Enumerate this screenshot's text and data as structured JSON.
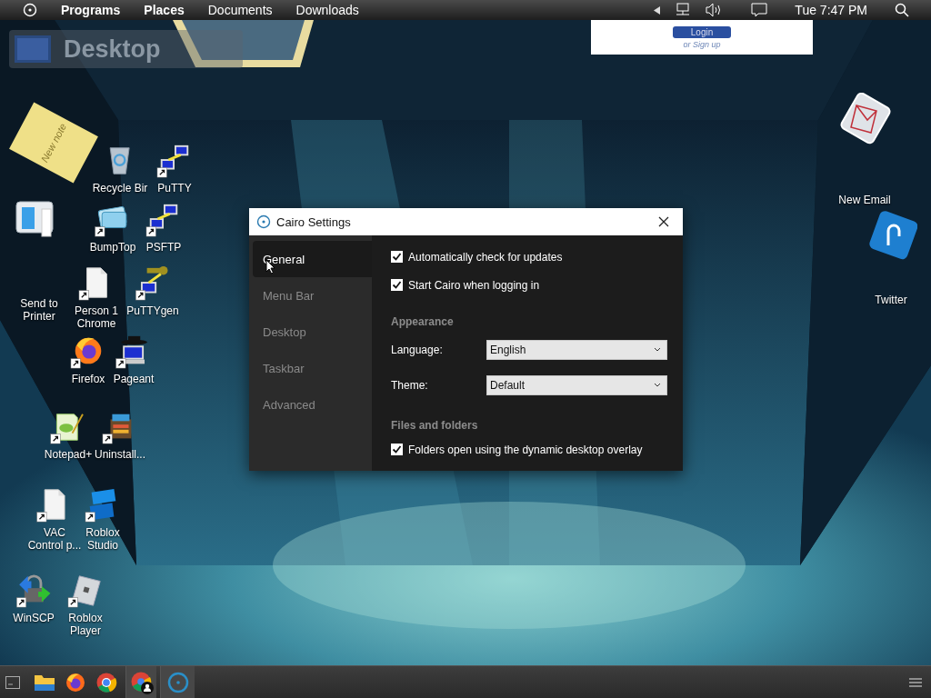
{
  "menu_bar": {
    "items": [
      {
        "label": "Programs",
        "emphasized": true
      },
      {
        "label": "Places",
        "emphasized": true
      },
      {
        "label": "Documents",
        "emphasized": false
      },
      {
        "label": "Downloads",
        "emphasized": false
      }
    ],
    "clock": "Tue 7:47 PM"
  },
  "wall": {
    "label": "Desktop",
    "sticky_note": "New note",
    "web_card": {
      "button": "Login",
      "link": "or Sign up"
    }
  },
  "desktop_icons": [
    {
      "label": "Recycle Bir",
      "kind": "recycle"
    },
    {
      "label": "PuTTY",
      "kind": "putty"
    },
    {
      "label": "BumpTop",
      "kind": "bumptop"
    },
    {
      "label": "PSFTP",
      "kind": "putty"
    },
    {
      "label": "Person 1\nChrome",
      "kind": "document"
    },
    {
      "label": "PuTTYgen",
      "kind": "puttygen"
    },
    {
      "label": "Firefox",
      "kind": "firefox"
    },
    {
      "label": "Pageant",
      "kind": "pageant"
    },
    {
      "label": "Notepad+",
      "kind": "notepad"
    },
    {
      "label": "Uninstall...",
      "kind": "toolbox"
    },
    {
      "label": "VAC\nControl p...",
      "kind": "document"
    },
    {
      "label": "Roblox\nStudio",
      "kind": "studio"
    },
    {
      "label": "WinSCP",
      "kind": "winscp"
    },
    {
      "label": "Roblox\nPlayer",
      "kind": "player"
    },
    {
      "label": "Send to\nPrinter",
      "kind": "printer"
    },
    {
      "label": "New Email",
      "kind": "email"
    },
    {
      "label": "Twitter",
      "kind": "twitter"
    }
  ],
  "settings_window": {
    "title": "Cairo Settings",
    "tabs": [
      {
        "label": "General",
        "selected": true
      },
      {
        "label": "Menu Bar",
        "selected": false
      },
      {
        "label": "Desktop",
        "selected": false
      },
      {
        "label": "Taskbar",
        "selected": false
      },
      {
        "label": "Advanced",
        "selected": false
      }
    ],
    "content": [
      {
        "kind": "checkbox",
        "label": "Automatically check for updates",
        "checked": true
      },
      {
        "kind": "checkbox",
        "label": "Start Cairo when logging in",
        "checked": true
      },
      {
        "kind": "heading",
        "label": "Appearance"
      },
      {
        "kind": "select",
        "label": "Language:",
        "value": "English"
      },
      {
        "kind": "select",
        "label": "Theme:",
        "value": "Default"
      },
      {
        "kind": "heading",
        "label": "Files and folders"
      },
      {
        "kind": "checkbox",
        "label": "Folders open using the dynamic desktop overlay",
        "checked": true
      }
    ]
  },
  "taskbar": {
    "items": [
      {
        "kind": "folder",
        "active": false
      },
      {
        "kind": "firefox",
        "active": false
      },
      {
        "kind": "chrome",
        "active": false
      },
      {
        "kind": "chrome-person",
        "active": true
      },
      {
        "kind": "cairo",
        "active": true
      }
    ]
  }
}
